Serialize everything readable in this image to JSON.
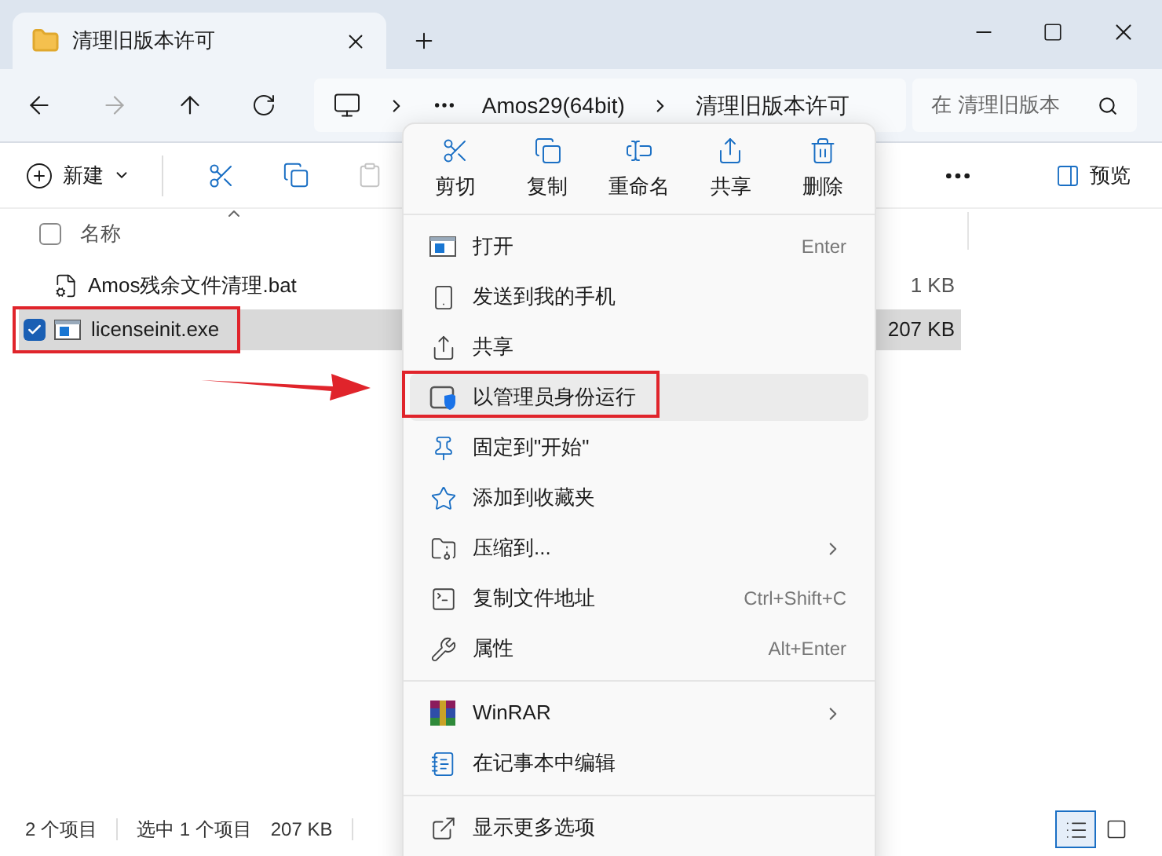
{
  "window": {
    "tab_title": "清理旧版本许可"
  },
  "address": {
    "crumbs": [
      "Amos29(64bit)",
      "清理旧版本许可"
    ],
    "search_placeholder": "在 清理旧版本"
  },
  "toolbar": {
    "new_label": "新建",
    "paste_disabled": true,
    "preview_label": "预览"
  },
  "select_all_checked": false,
  "columns": [
    {
      "label": "名称"
    }
  ],
  "files": [
    {
      "name": "Amos残余文件清理.bat",
      "size": "1 KB",
      "selected": false
    },
    {
      "name": "licenseinit.exe",
      "size": "207 KB",
      "selected": true
    }
  ],
  "status_bar": {
    "count": "2 个项目",
    "selection": "选中 1 个项目",
    "size": "207 KB",
    "views": [
      {
        "selected": true
      },
      {
        "selected": false
      }
    ]
  },
  "context_menu": {
    "actions": [
      {
        "label": "剪切"
      },
      {
        "label": "复制"
      },
      {
        "label": "重命名"
      },
      {
        "label": "共享"
      },
      {
        "label": "删除"
      }
    ],
    "sections": [
      [
        {
          "label": "打开",
          "shortcut": "Enter",
          "submenu": false,
          "selected": false
        },
        {
          "label": "发送到我的手机",
          "submenu": false,
          "selected": false
        },
        {
          "label": "共享",
          "submenu": false,
          "selected": false
        },
        {
          "label": "以管理员身份运行",
          "submenu": false,
          "selected": true
        },
        {
          "label": "固定到\"开始\"",
          "submenu": false,
          "selected": false
        },
        {
          "label": "添加到收藏夹",
          "submenu": false,
          "selected": false
        },
        {
          "label": "压缩到...",
          "submenu": true,
          "selected": false
        },
        {
          "label": "复制文件地址",
          "shortcut": "Ctrl+Shift+C",
          "submenu": false,
          "selected": false
        },
        {
          "label": "属性",
          "shortcut": "Alt+Enter",
          "submenu": false,
          "selected": false
        }
      ],
      [
        {
          "label": "WinRAR",
          "submenu": true,
          "selected": false
        },
        {
          "label": "在记事本中编辑",
          "submenu": false,
          "selected": false
        }
      ],
      [
        {
          "label": "显示更多选项",
          "submenu": false,
          "selected": false
        }
      ]
    ]
  }
}
